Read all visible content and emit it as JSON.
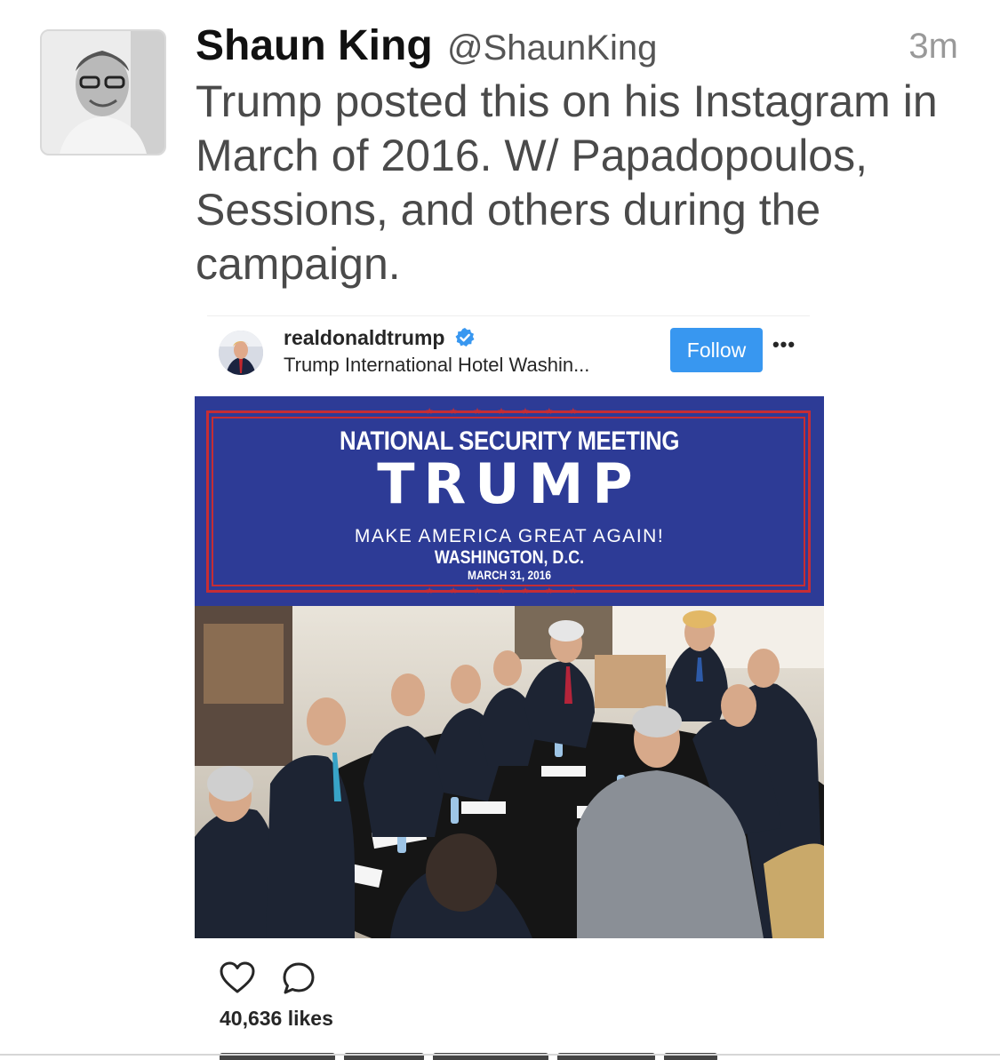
{
  "tweet": {
    "author_name": "Shaun King",
    "author_handle": "@ShaunKing",
    "timestamp": "3m",
    "text": "Trump posted this on his Instagram in March of 2016. W/ Papadopoulos, Sessions, and others during the campaign."
  },
  "instagram_post": {
    "username": "realdonaldtrump",
    "location": "Trump International Hotel Washin...",
    "follow_label": "Follow",
    "likes": "40,636 likes",
    "banner": {
      "line1": "NATIONAL SECURITY MEETING",
      "line2": "TRUMP",
      "line3": "MAKE AMERICA GREAT AGAIN!",
      "line4": "WASHINGTON, D.C.",
      "line5": "MARCH 31, 2016"
    }
  },
  "icons": {
    "verified": "verified-badge-icon",
    "more": "more-options-icon",
    "like": "heart-icon",
    "comment": "speech-bubble-icon"
  },
  "colors": {
    "follow_button": "#3897f0",
    "banner_blue": "#2d3b96",
    "banner_red": "#c62d34",
    "verified": "#3897f0"
  }
}
